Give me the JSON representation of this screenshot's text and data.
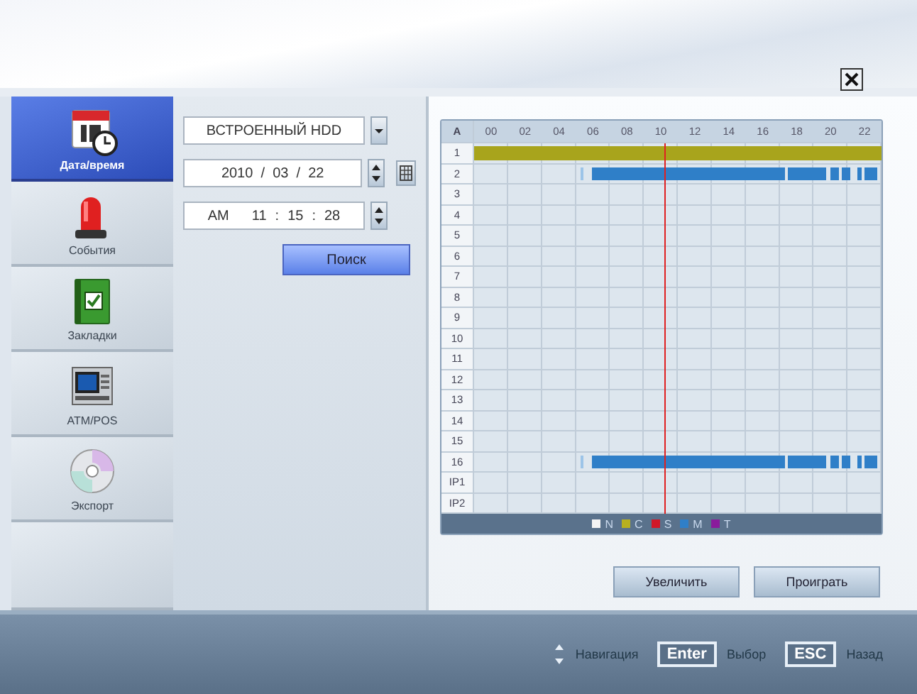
{
  "sidebar": {
    "items": [
      {
        "label": "Дата/время",
        "selected": true
      },
      {
        "label": "События",
        "selected": false
      },
      {
        "label": "Закладки",
        "selected": false
      },
      {
        "label": "ATM/POS",
        "selected": false
      },
      {
        "label": "Экспорт",
        "selected": false
      }
    ]
  },
  "search": {
    "source": "ВСТРОЕННЫЙ HDD",
    "date": "2010  /  03  /  22",
    "time": {
      "ampm": "AM",
      "hour": "11",
      "minute": "15",
      "second": "28",
      "separator": ":"
    },
    "button": "Поиск"
  },
  "timeline": {
    "corner": "A",
    "hours": [
      "00",
      "02",
      "04",
      "06",
      "08",
      "10",
      "12",
      "14",
      "16",
      "18",
      "20",
      "22"
    ],
    "rows": [
      {
        "label": "1",
        "kind": "continuous"
      },
      {
        "label": "2",
        "kind": "motion"
      },
      {
        "label": "3",
        "kind": "empty"
      },
      {
        "label": "4",
        "kind": "empty"
      },
      {
        "label": "5",
        "kind": "empty"
      },
      {
        "label": "6",
        "kind": "empty"
      },
      {
        "label": "7",
        "kind": "empty"
      },
      {
        "label": "8",
        "kind": "empty"
      },
      {
        "label": "9",
        "kind": "empty"
      },
      {
        "label": "10",
        "kind": "empty"
      },
      {
        "label": "11",
        "kind": "empty"
      },
      {
        "label": "12",
        "kind": "empty"
      },
      {
        "label": "13",
        "kind": "empty"
      },
      {
        "label": "14",
        "kind": "empty"
      },
      {
        "label": "15",
        "kind": "empty"
      },
      {
        "label": "16",
        "kind": "motion"
      },
      {
        "label": "IP1",
        "kind": "empty"
      },
      {
        "label": "IP2",
        "kind": "empty"
      }
    ],
    "legend": [
      {
        "label": "N",
        "color": "#f4f4f4"
      },
      {
        "label": "C",
        "color": "#b8b020"
      },
      {
        "label": "S",
        "color": "#d01828"
      },
      {
        "label": "M",
        "color": "#2f7fc8"
      },
      {
        "label": "T",
        "color": "#8a1c9c"
      }
    ]
  },
  "actions": [
    "Увеличить",
    "Проиграть"
  ],
  "footer": [
    {
      "kind": "arrows",
      "label": "Навигация"
    },
    {
      "kind": "key",
      "key": "Enter",
      "label": "Выбор"
    },
    {
      "kind": "key",
      "key": "ESC",
      "label": "Назад"
    }
  ]
}
